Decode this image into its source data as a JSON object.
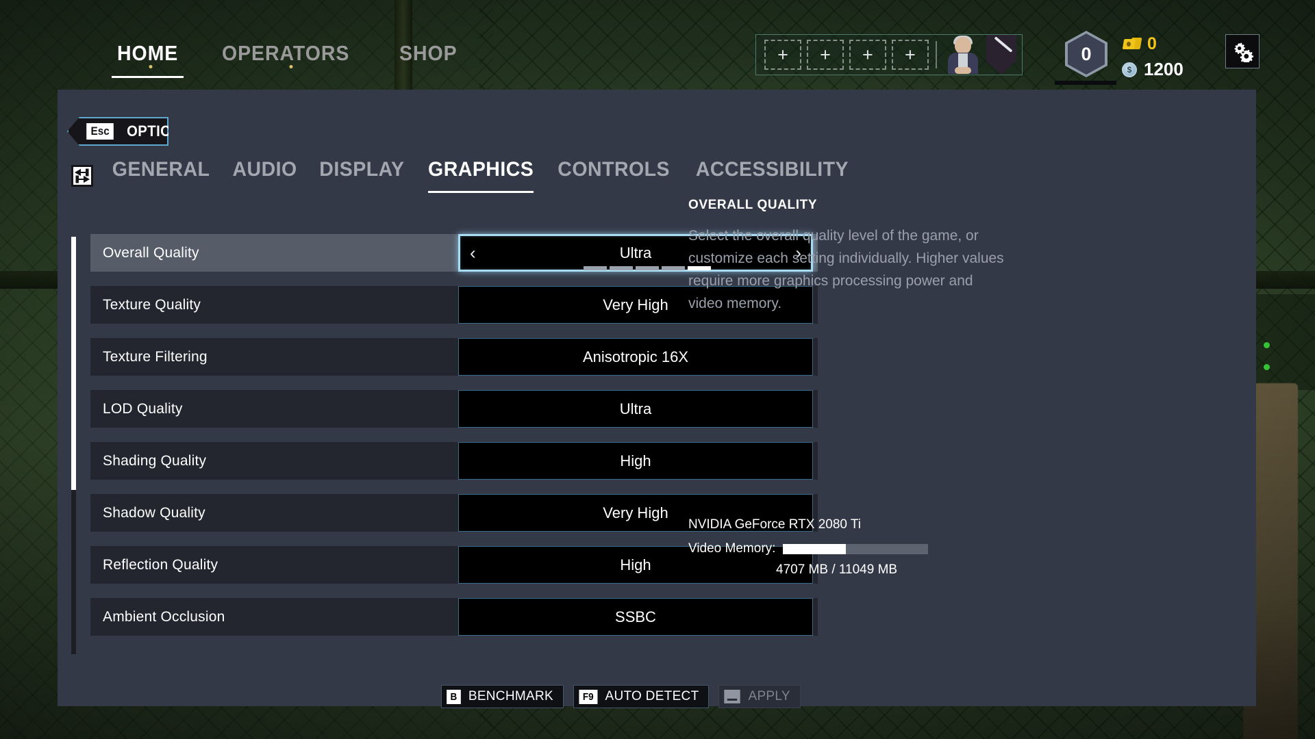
{
  "topnav": {
    "items": [
      {
        "label": "HOME",
        "active": true,
        "dot": true
      },
      {
        "label": "OPERATORS",
        "active": false,
        "dot": true
      },
      {
        "label": "SHOP",
        "active": false,
        "dot": false
      }
    ],
    "loadout": {
      "slots": [
        "+",
        "+",
        "+",
        "+"
      ],
      "portrait_name": "operator-avatar",
      "weapon_badge_name": "weapon-icon"
    },
    "level": {
      "value": "0",
      "badge_name": "level-hexagon"
    },
    "credits": {
      "value": "0",
      "icon": "credits-icon",
      "color": "#f0c419"
    },
    "coins": {
      "value": "1200",
      "icon": "coin-icon",
      "color": "#ffffff"
    },
    "settings_button": {
      "icon": "gear-icon"
    }
  },
  "options": {
    "esc_key": "Esc",
    "title": "OPTIONS",
    "tabs": [
      {
        "label": "GENERAL",
        "active": false
      },
      {
        "label": "AUDIO",
        "active": false
      },
      {
        "label": "DISPLAY",
        "active": false
      },
      {
        "label": "GRAPHICS",
        "active": true
      },
      {
        "label": "CONTROLS",
        "active": false
      },
      {
        "label": "ACCESSIBILITY",
        "active": false
      }
    ],
    "tab_nav_icon": "tab-switch-keys-icon"
  },
  "settings": [
    {
      "label": "Overall Quality",
      "value": "Ultra",
      "selected": true,
      "stepper": true,
      "segments": 5,
      "segment_active": 5
    },
    {
      "label": "Texture Quality",
      "value": "Very High",
      "selected": false,
      "stepper": false
    },
    {
      "label": "Texture Filtering",
      "value": "Anisotropic 16X",
      "selected": false,
      "stepper": false
    },
    {
      "label": "LOD Quality",
      "value": "Ultra",
      "selected": false,
      "stepper": false
    },
    {
      "label": "Shading Quality",
      "value": "High",
      "selected": false,
      "stepper": false
    },
    {
      "label": "Shadow Quality",
      "value": "Very High",
      "selected": false,
      "stepper": false
    },
    {
      "label": "Reflection Quality",
      "value": "High",
      "selected": false,
      "stepper": false
    },
    {
      "label": "Ambient Occlusion",
      "value": "SSBC",
      "selected": false,
      "stepper": false
    }
  ],
  "description": {
    "title": "OVERALL QUALITY",
    "body": "Select the overall quality level of the game, or customize each setting individually. Higher values require more graphics processing power and video memory."
  },
  "actions": [
    {
      "key": "B",
      "label": "BENCHMARK",
      "disabled": false,
      "key_style": "letter"
    },
    {
      "key": "F9",
      "label": "AUTO DETECT",
      "disabled": false,
      "key_style": "letter"
    },
    {
      "key": "",
      "label": "APPLY",
      "disabled": true,
      "key_style": "space"
    }
  ],
  "gpu": {
    "name": "NVIDIA GeForce RTX 2080 Ti",
    "vram_label": "Video Memory:",
    "vram_used_mb": 4707,
    "vram_total_mb": 11049,
    "vram_text": "4707 MB / 11049 MB",
    "vram_percent": 43
  },
  "colors": {
    "panel_bg": "#343947",
    "row_bg": "#23262e",
    "row_selected_bg": "#565c68",
    "accent_blue": "#5fa8cf",
    "highlight_blue": "#a9dcf2",
    "value_bg": "#000000",
    "credits_yellow": "#f0c419"
  }
}
